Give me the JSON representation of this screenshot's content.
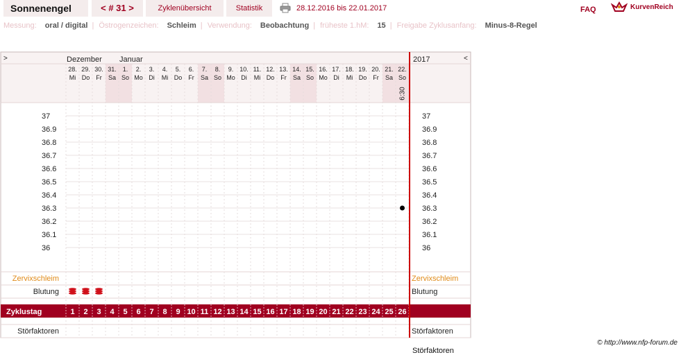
{
  "header": {
    "brand": "Sonnenengel",
    "cycle_nav": "< # 31 >",
    "tabs": [
      "Zyklenübersicht",
      "Statistik"
    ],
    "date_range": "28.12.2016 bis 22.01.2017",
    "faq": "FAQ",
    "logo": "KurvenReich"
  },
  "info": [
    {
      "key": "Messung:",
      "value": "oral / digital"
    },
    {
      "key": "Östrogenzeichen:",
      "value": "Schleim"
    },
    {
      "key": "Verwendung:",
      "value": "Beobachtung"
    },
    {
      "key": "früheste 1.hM:",
      "value": "15"
    },
    {
      "key": "Freigabe Zyklusanfang:",
      "value": "Minus-8-Regel"
    }
  ],
  "chart_data": {
    "type": "scatter",
    "months": [
      "Dezember",
      "Januar"
    ],
    "year_label": "2017",
    "prev_arrow": ">",
    "next_arrow": "<",
    "days": [
      {
        "date": "28.",
        "wd": "Mi"
      },
      {
        "date": "29.",
        "wd": "Do"
      },
      {
        "date": "30.",
        "wd": "Fr"
      },
      {
        "date": "31.",
        "wd": "Sa"
      },
      {
        "date": "1.",
        "wd": "So"
      },
      {
        "date": "2.",
        "wd": "Mo"
      },
      {
        "date": "3.",
        "wd": "Di"
      },
      {
        "date": "4.",
        "wd": "Mi"
      },
      {
        "date": "5.",
        "wd": "Do"
      },
      {
        "date": "6.",
        "wd": "Fr"
      },
      {
        "date": "7.",
        "wd": "Sa"
      },
      {
        "date": "8.",
        "wd": "So"
      },
      {
        "date": "9.",
        "wd": "Mo"
      },
      {
        "date": "10.",
        "wd": "Di"
      },
      {
        "date": "11.",
        "wd": "Mi"
      },
      {
        "date": "12.",
        "wd": "Do"
      },
      {
        "date": "13.",
        "wd": "Fr"
      },
      {
        "date": "14.",
        "wd": "Sa"
      },
      {
        "date": "15.",
        "wd": "So"
      },
      {
        "date": "16.",
        "wd": "Mo"
      },
      {
        "date": "17.",
        "wd": "Di"
      },
      {
        "date": "18.",
        "wd": "Mi"
      },
      {
        "date": "19.",
        "wd": "Do"
      },
      {
        "date": "20.",
        "wd": "Fr"
      },
      {
        "date": "21.",
        "wd": "Sa"
      },
      {
        "date": "22.",
        "wd": "So"
      }
    ],
    "weekend_indices": [
      3,
      4,
      10,
      11,
      17,
      18,
      24,
      25
    ],
    "time_label": {
      "day_index": 25,
      "text": "6:30"
    },
    "y_ticks": [
      "37",
      "36.9",
      "36.8",
      "36.7",
      "36.6",
      "36.5",
      "36.4",
      "36.3",
      "36.2",
      "36.1",
      "36"
    ],
    "ylim": [
      36.0,
      37.0
    ],
    "points": [
      {
        "cycle_day": 26,
        "value": 36.3
      }
    ],
    "zervix_label": "Zervixschleim",
    "blutung_label": "Blutung",
    "bleeding_days": [
      1,
      2,
      3
    ],
    "zyklustag_label": "Zyklustag",
    "cycle_days": [
      "1",
      "2",
      "3",
      "4",
      "5",
      "6",
      "7",
      "8",
      "9",
      "10",
      "11",
      "12",
      "13",
      "14",
      "15",
      "16",
      "17",
      "18",
      "19",
      "20",
      "21",
      "22",
      "23",
      "24",
      "25",
      "26"
    ],
    "stoer_label": "Störfaktoren",
    "stoer_overflow": "Störfaktoren"
  },
  "footer": {
    "copyright": "© http://www.nfp-forum.de"
  },
  "colors": {
    "accent": "#a00020",
    "header_bg": "#f4ecec",
    "weekend": "#f2e0e2",
    "zervix": "#e08a18",
    "cursor_line": "#cc0000"
  }
}
